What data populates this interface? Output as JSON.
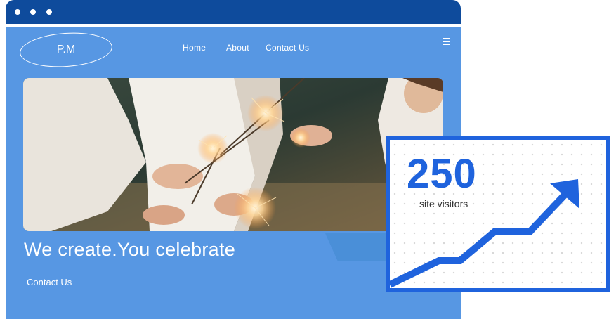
{
  "window": {
    "controls": [
      "dot",
      "dot",
      "dot"
    ]
  },
  "site": {
    "logo_text": "P.M",
    "nav": [
      {
        "label": "Home"
      },
      {
        "label": "About"
      },
      {
        "label": "Contact Us"
      }
    ],
    "menu_icon": "hamburger-menu-icon",
    "hero_image": "family holding sparklers at dusk",
    "headline": "We create.You celebrate",
    "cta_label": "Contact Us"
  },
  "stats_card": {
    "value": "250",
    "label": "site visitors",
    "trend_icon": "upward-trend-arrow-icon"
  },
  "colors": {
    "titlebar": "#0e4b9c",
    "page_bg": "#5797e3",
    "accent": "#1f63dd",
    "text_on_blue": "#ffffff"
  }
}
